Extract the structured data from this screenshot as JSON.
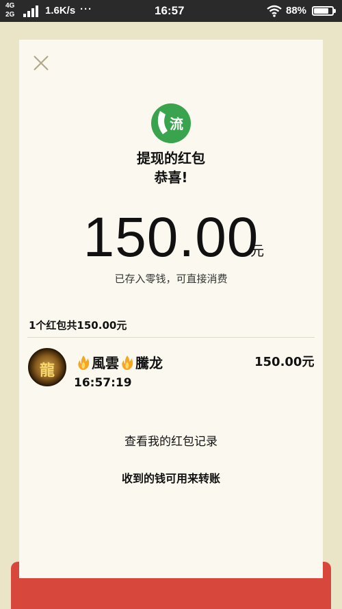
{
  "status_bar": {
    "network_top": "4G",
    "network_bottom": "2G",
    "speed": "1.6K/s",
    "dots": "···",
    "time": "16:57",
    "battery_percent": "88%",
    "battery_level": 0.88
  },
  "header": {
    "close_icon": "close-icon",
    "logo_text": "流",
    "title": "提现的红包",
    "subtitle": "恭喜!"
  },
  "amount": {
    "value": "150.00",
    "unit": "元",
    "note": "已存入零钱，可直接消费"
  },
  "summary": "1个红包共150.00元",
  "record": {
    "avatar_text": "龍",
    "name_left": "風雲",
    "name_right": "騰龙",
    "time": "16:57:19",
    "amount": "150.00元"
  },
  "links": {
    "history": "查看我的红包记录",
    "transfer": "收到的钱可用来转账"
  },
  "colors": {
    "background": "#e9e5c6",
    "card": "#fbf9ef",
    "red": "#d8473c",
    "logo_green": "#3aa34e"
  }
}
